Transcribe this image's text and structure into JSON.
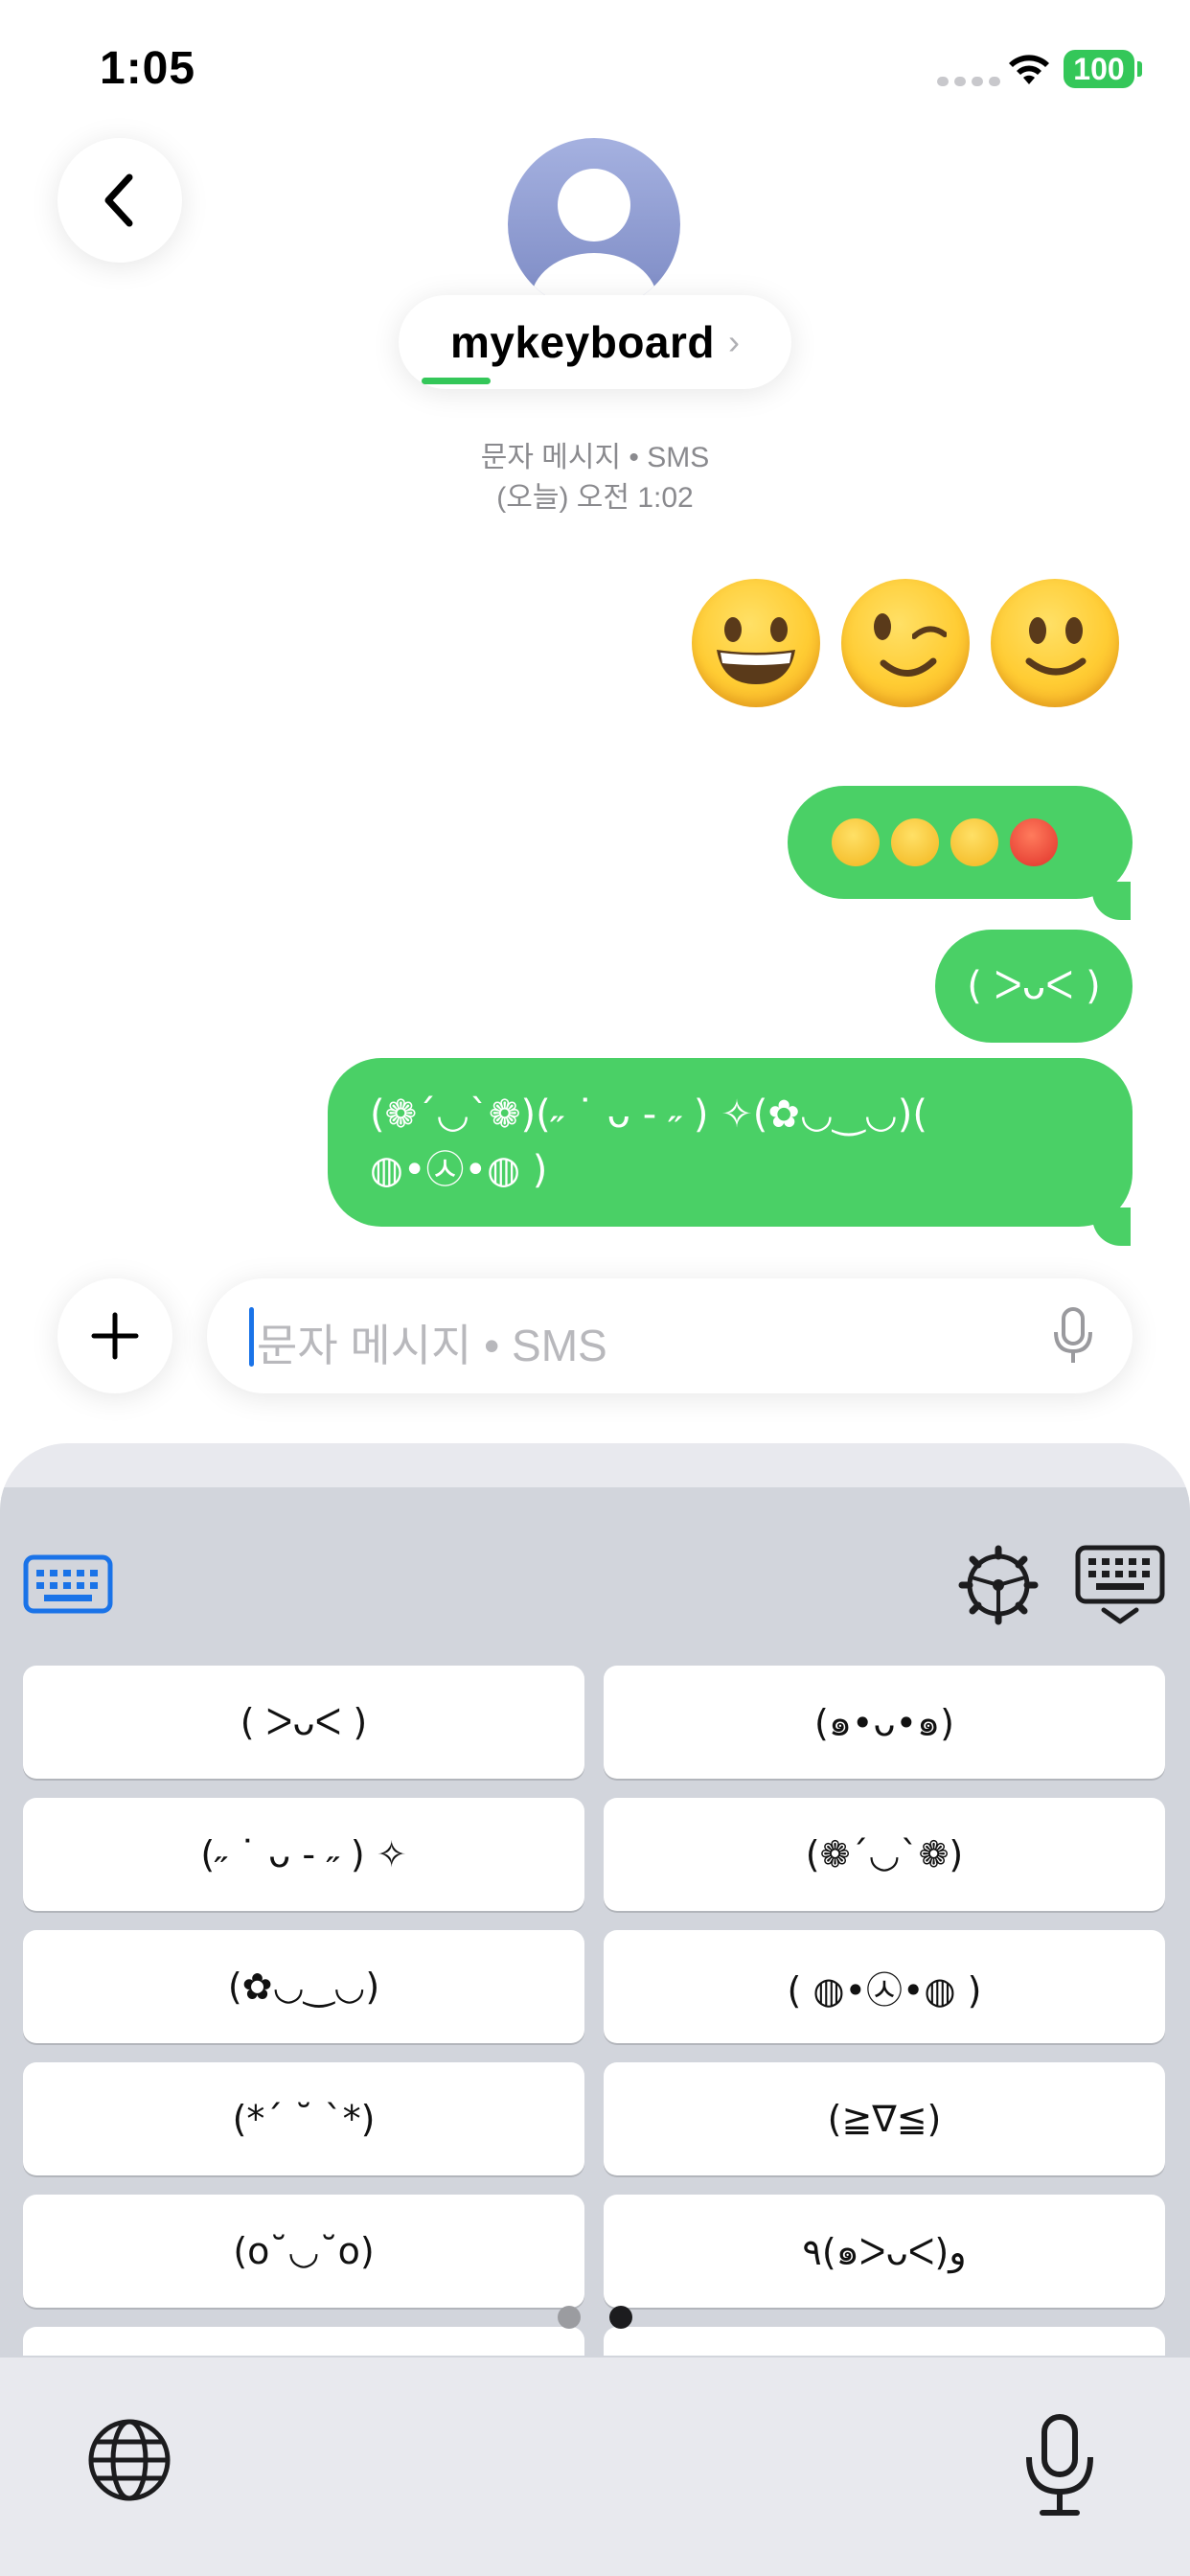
{
  "status_bar": {
    "time": "1:05",
    "battery": "100"
  },
  "header": {
    "contact_name": "mykeyboard",
    "contact_chevron": "›",
    "meta_line_1": "문자 메시지 • SMS",
    "meta_line_2": "(오늘) 오전 1:02"
  },
  "messages": {
    "big_emojis": [
      "grinning-face",
      "winking-face",
      "slightly-smiling-face"
    ],
    "bubble_1_emojis": [
      "grinning-face",
      "tears-of-joy-face",
      "slightly-smiling-face",
      "angry-face"
    ],
    "bubble_2": "( ᐳᴗᐸ )",
    "bubble_3_line_1": "(❁´◡`❁)(˶ ˙ ᴗ - ˶ ) ✧(✿◡‿◡)(",
    "bubble_3_line_2": "◍•㉦•◍ )"
  },
  "composer": {
    "placeholder": "문자 메시지 • SMS"
  },
  "keyboard": {
    "kaomoji": [
      "( ᐳᴗᐸ )",
      "(๑•ᴗ•๑)",
      "(˶ ˙ ᴗ - ˶ ) ✧",
      "(❁´◡`❁)",
      "(✿◡‿◡)",
      "( ◍•㉦•◍ )",
      "(*´ ˘ `*)",
      "(≧∇≦)",
      "(o˘◡˘o)",
      "٩(๑ᐳᴗᐸ)و"
    ],
    "pages": 2,
    "active_page": 2
  },
  "colors": {
    "bubble_green": "#4ad066",
    "accent_blue": "#1a73e8",
    "battery_green": "#34c759"
  }
}
